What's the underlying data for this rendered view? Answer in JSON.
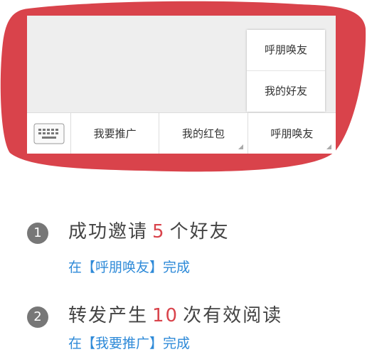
{
  "popup": {
    "items": [
      "呼朋唤友",
      "我的好友"
    ]
  },
  "menubar": {
    "items": [
      "我要推广",
      "我的红包",
      "呼朋唤友"
    ]
  },
  "steps": [
    {
      "num": "1",
      "title_pre": "成功邀请",
      "highlight": "5",
      "title_post": "个好友",
      "sub": "在【呼朋唤友】完成"
    },
    {
      "num": "2",
      "title_pre": "转发产生",
      "highlight": "10",
      "title_post": "次有效阅读",
      "sub": "在【我要推广】完成"
    }
  ],
  "colors": {
    "blob": "#d9434b",
    "highlight": "#d9434b",
    "link": "#2e8ad8"
  }
}
